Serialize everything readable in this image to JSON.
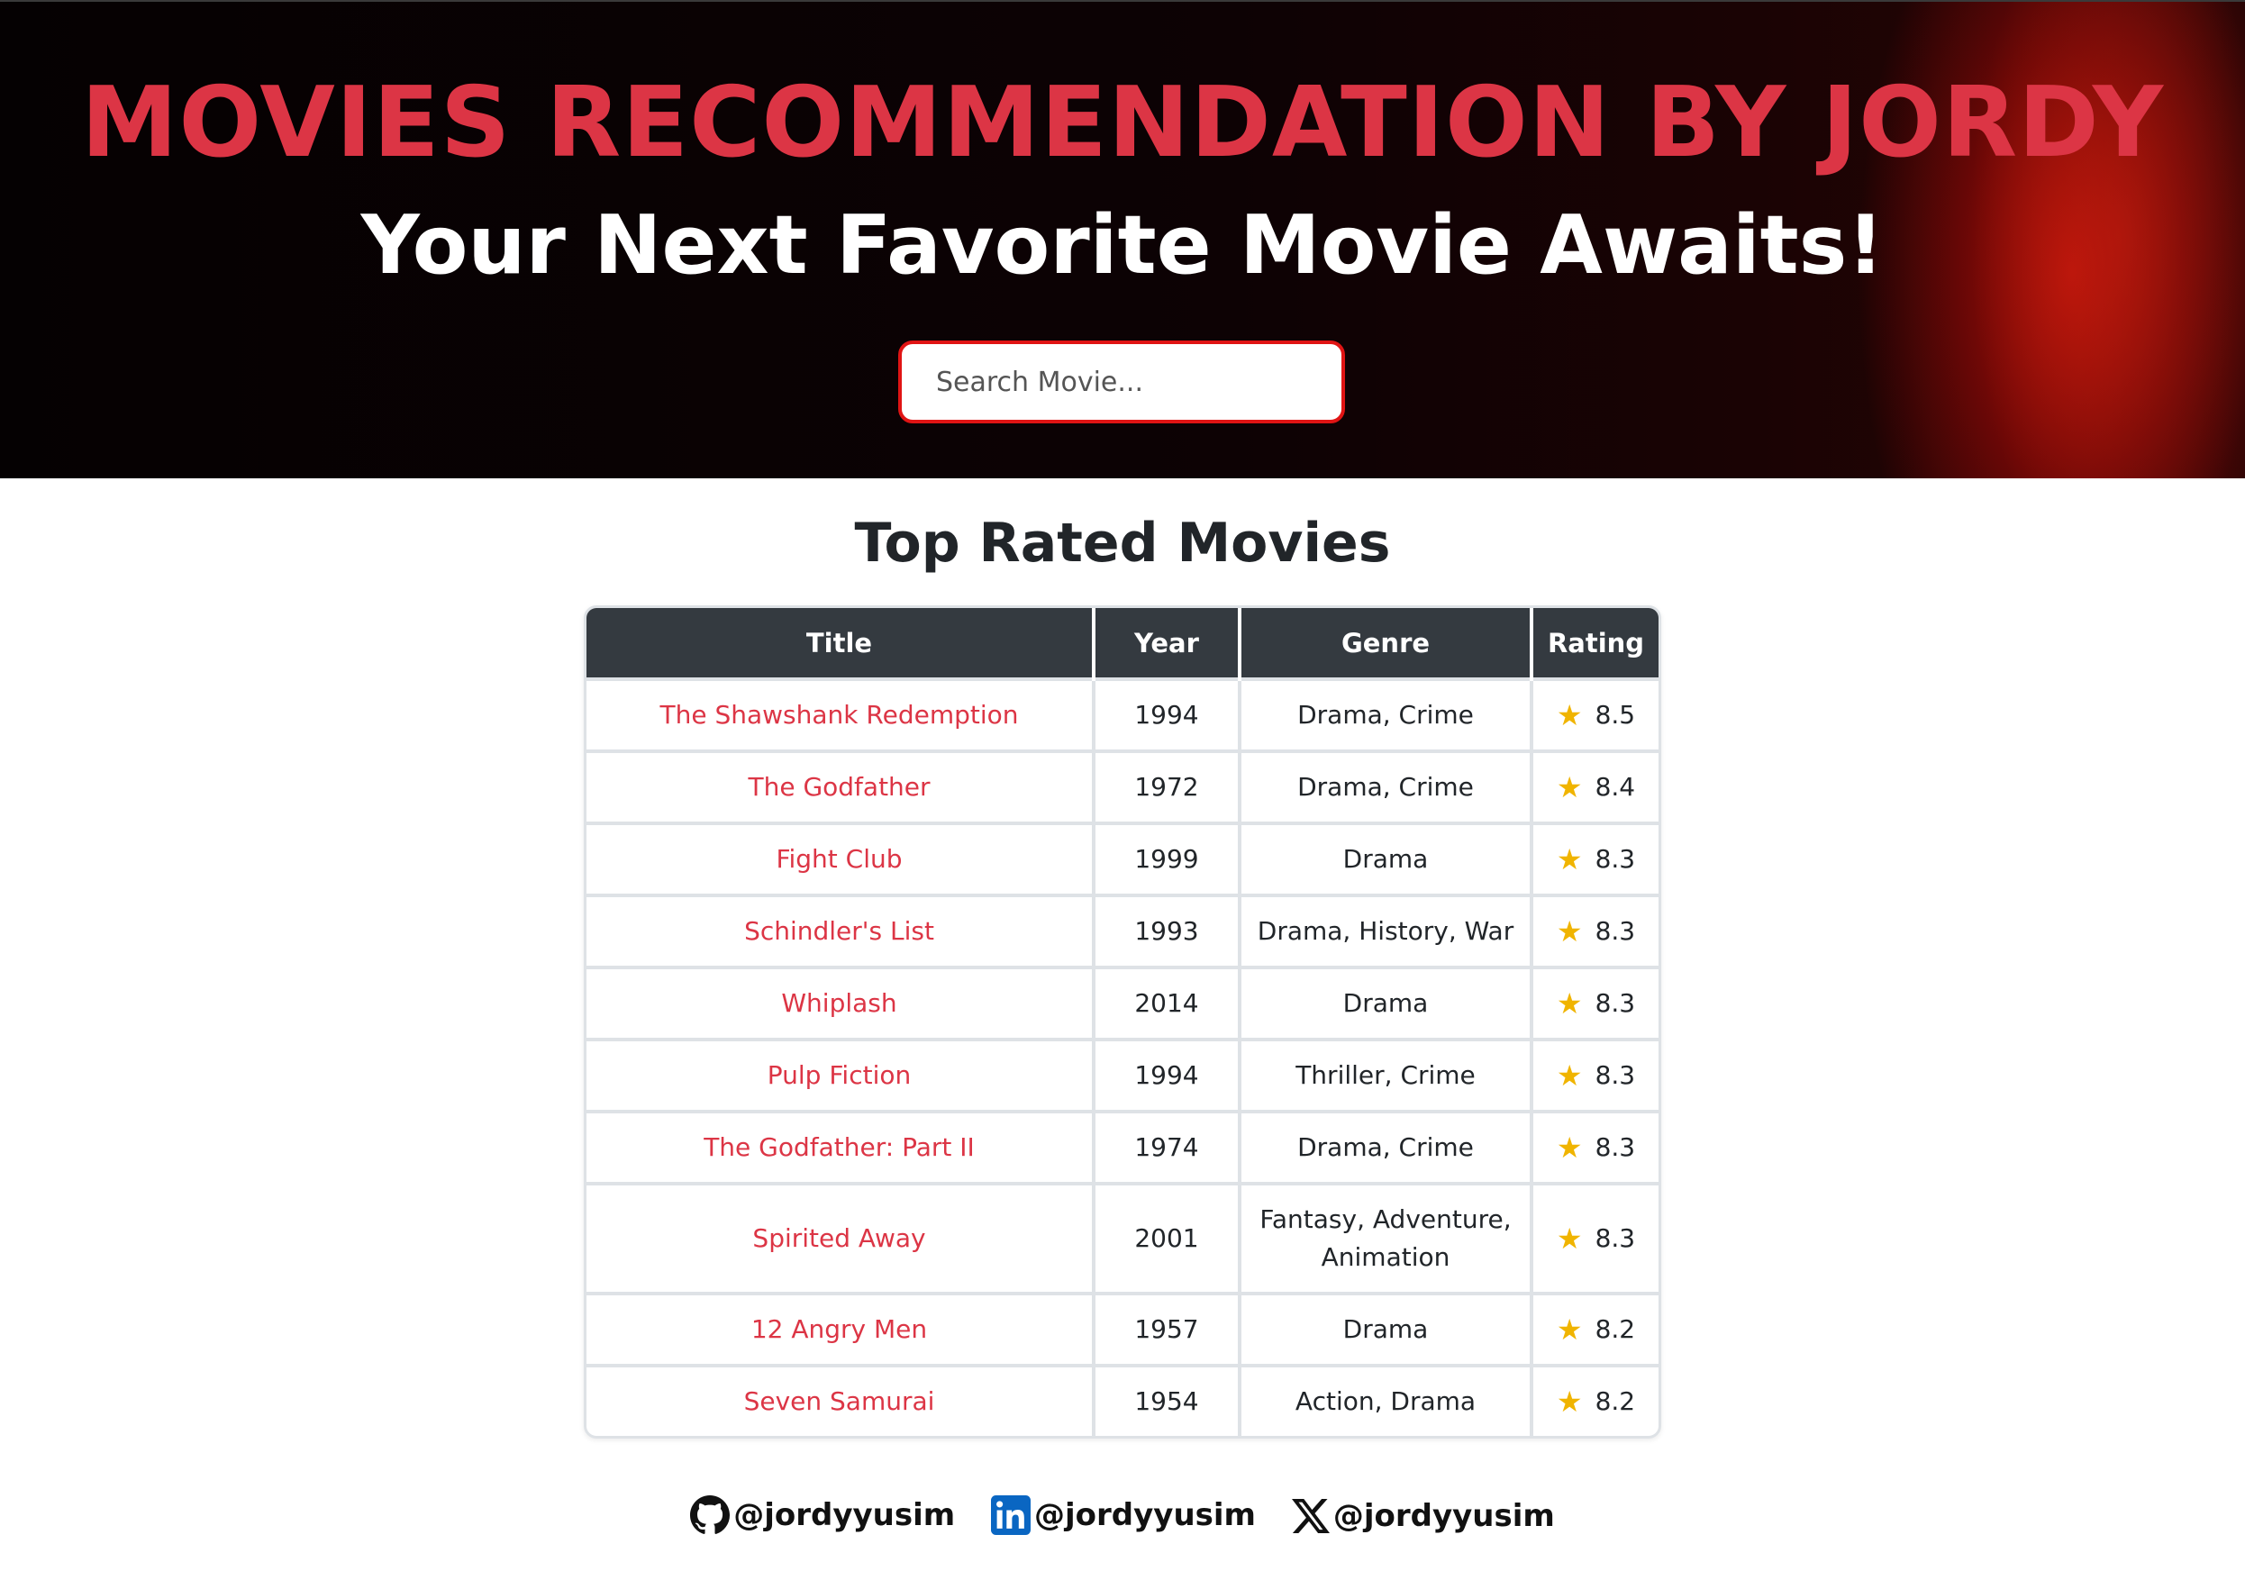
{
  "header": {
    "title": "MOVIES RECOMMENDATION BY JORDY",
    "subtitle": "Your Next Favorite Movie Awaits!",
    "search_placeholder": "Search Movie..."
  },
  "section": {
    "title": "Top Rated Movies"
  },
  "table": {
    "columns": [
      "Title",
      "Year",
      "Genre",
      "Rating"
    ],
    "rows": [
      {
        "title": "The Shawshank Redemption",
        "year": "1994",
        "genre": "Drama, Crime",
        "rating": "8.5"
      },
      {
        "title": "The Godfather",
        "year": "1972",
        "genre": "Drama, Crime",
        "rating": "8.4"
      },
      {
        "title": "Fight Club",
        "year": "1999",
        "genre": "Drama",
        "rating": "8.3"
      },
      {
        "title": "Schindler's List",
        "year": "1993",
        "genre": "Drama, History, War",
        "rating": "8.3"
      },
      {
        "title": "Whiplash",
        "year": "2014",
        "genre": "Drama",
        "rating": "8.3"
      },
      {
        "title": "Pulp Fiction",
        "year": "1994",
        "genre": "Thriller, Crime",
        "rating": "8.3"
      },
      {
        "title": "The Godfather: Part II",
        "year": "1974",
        "genre": "Drama, Crime",
        "rating": "8.3"
      },
      {
        "title": "Spirited Away",
        "year": "2001",
        "genre": "Fantasy, Adventure, Animation",
        "rating": "8.3"
      },
      {
        "title": "12 Angry Men",
        "year": "1957",
        "genre": "Drama",
        "rating": "8.2"
      },
      {
        "title": "Seven Samurai",
        "year": "1954",
        "genre": "Action, Drama",
        "rating": "8.2"
      }
    ]
  },
  "footer": {
    "links": [
      {
        "icon": "github-icon",
        "handle": "@jordyyusim"
      },
      {
        "icon": "linkedin-icon",
        "handle": "@jordyyusim"
      },
      {
        "icon": "x-icon",
        "handle": "@jordyyusim"
      }
    ]
  },
  "colors": {
    "accent_red": "#dc3545",
    "header_dark": "#343a40",
    "star_gold": "#f0b400"
  }
}
